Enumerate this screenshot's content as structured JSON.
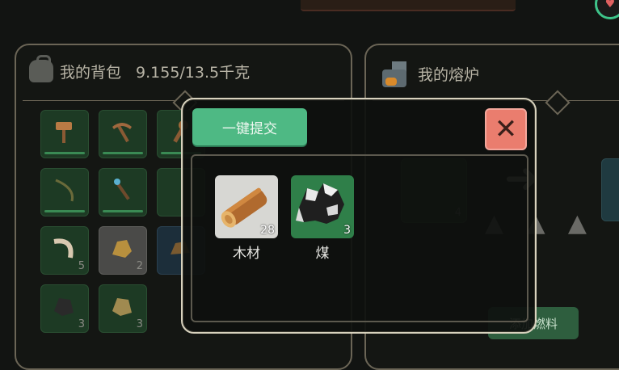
{
  "bag": {
    "title": "我的背包",
    "weight": "9.155/13.5千克",
    "slots": [
      {
        "tone": "green",
        "icon": "hammer-icon",
        "count": "",
        "bar": true
      },
      {
        "tone": "green",
        "icon": "pickaxe-icon",
        "count": "",
        "bar": true
      },
      {
        "tone": "green",
        "icon": "club-icon",
        "count": "",
        "bar": true
      },
      {
        "tone": "green",
        "icon": "bow-icon",
        "count": "",
        "bar": true
      },
      {
        "tone": "green",
        "icon": "spear-icon",
        "count": "",
        "bar": true
      },
      {
        "tone": "green",
        "icon": "horn-icon",
        "count": "5",
        "bar": false
      },
      {
        "tone": "gray",
        "icon": "gold-ore-icon",
        "count": "2",
        "bar": false
      },
      {
        "tone": "green",
        "icon": "coal-icon",
        "count": "3",
        "bar": false
      },
      {
        "tone": "green",
        "icon": "ore-icon",
        "count": "3",
        "bar": false
      }
    ]
  },
  "furnace": {
    "title": "我的熔炉",
    "slot_count": "4",
    "fuel_button": "添加燃料"
  },
  "modal": {
    "submit_label": "一键提交",
    "close_icon": "close-icon",
    "items": [
      {
        "name": "木材",
        "qty": "28",
        "icon": "wood-log-icon"
      },
      {
        "name": "煤",
        "qty": "3",
        "icon": "coal-icon"
      }
    ]
  },
  "colors": {
    "submit_green": "#4eb984",
    "close_red": "#ea7d6e",
    "slot_green": "#1d3a24",
    "coal_tile": "#2f7f49"
  }
}
